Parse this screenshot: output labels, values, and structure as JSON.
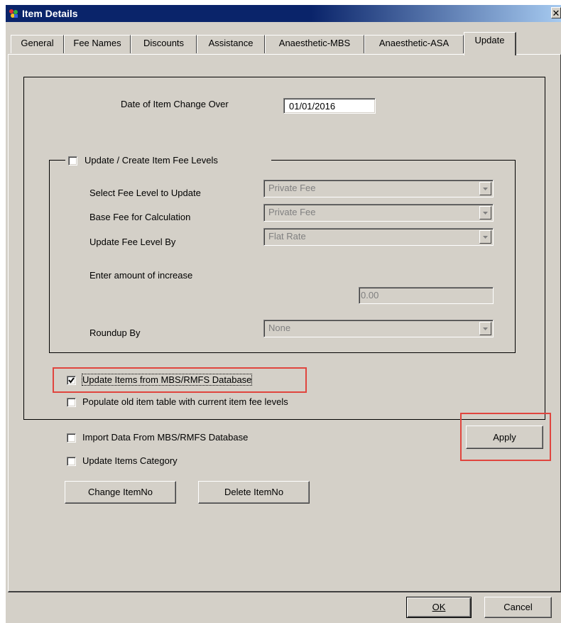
{
  "window": {
    "title": "Item Details",
    "close_glyph": "✕"
  },
  "tabs": [
    "General",
    "Fee Names",
    "Discounts",
    "Assistance",
    "Anaesthetic-MBS",
    "Anaesthetic-ASA",
    "Update"
  ],
  "active_tab": "Update",
  "changeover": {
    "label": "Date of Item Change Over",
    "value": "01/01/2016"
  },
  "fee_levels_group": {
    "checkbox_label": "Update / Create Item Fee Levels",
    "checked": false,
    "select_fee_level": {
      "label": "Select Fee Level to Update",
      "value": "Private Fee"
    },
    "base_fee": {
      "label": "Base Fee for Calculation",
      "value": "Private Fee"
    },
    "update_by": {
      "label": "Update Fee Level By",
      "value": "Flat Rate"
    },
    "increase": {
      "label": "Enter amount of increase",
      "value": "0.00"
    },
    "roundup": {
      "label": "Roundup By",
      "value": "None"
    }
  },
  "options": {
    "update_items_mbs": {
      "label": "Update Items from MBS/RMFS Database",
      "checked": true
    },
    "populate_old": {
      "label": "Populate old item table with current item fee levels",
      "checked": false
    },
    "import_data": {
      "label": "Import Data From MBS/RMFS Database",
      "checked": false
    },
    "update_category": {
      "label": "Update Items Category",
      "checked": false
    }
  },
  "buttons": {
    "apply": "Apply",
    "change_itemno": "Change ItemNo",
    "delete_itemno": "Delete ItemNo",
    "ok": "OK",
    "cancel": "Cancel"
  },
  "colors": {
    "titlebar": "#0a246a",
    "face": "#d4d0c8",
    "highlight": "#e0453e"
  }
}
